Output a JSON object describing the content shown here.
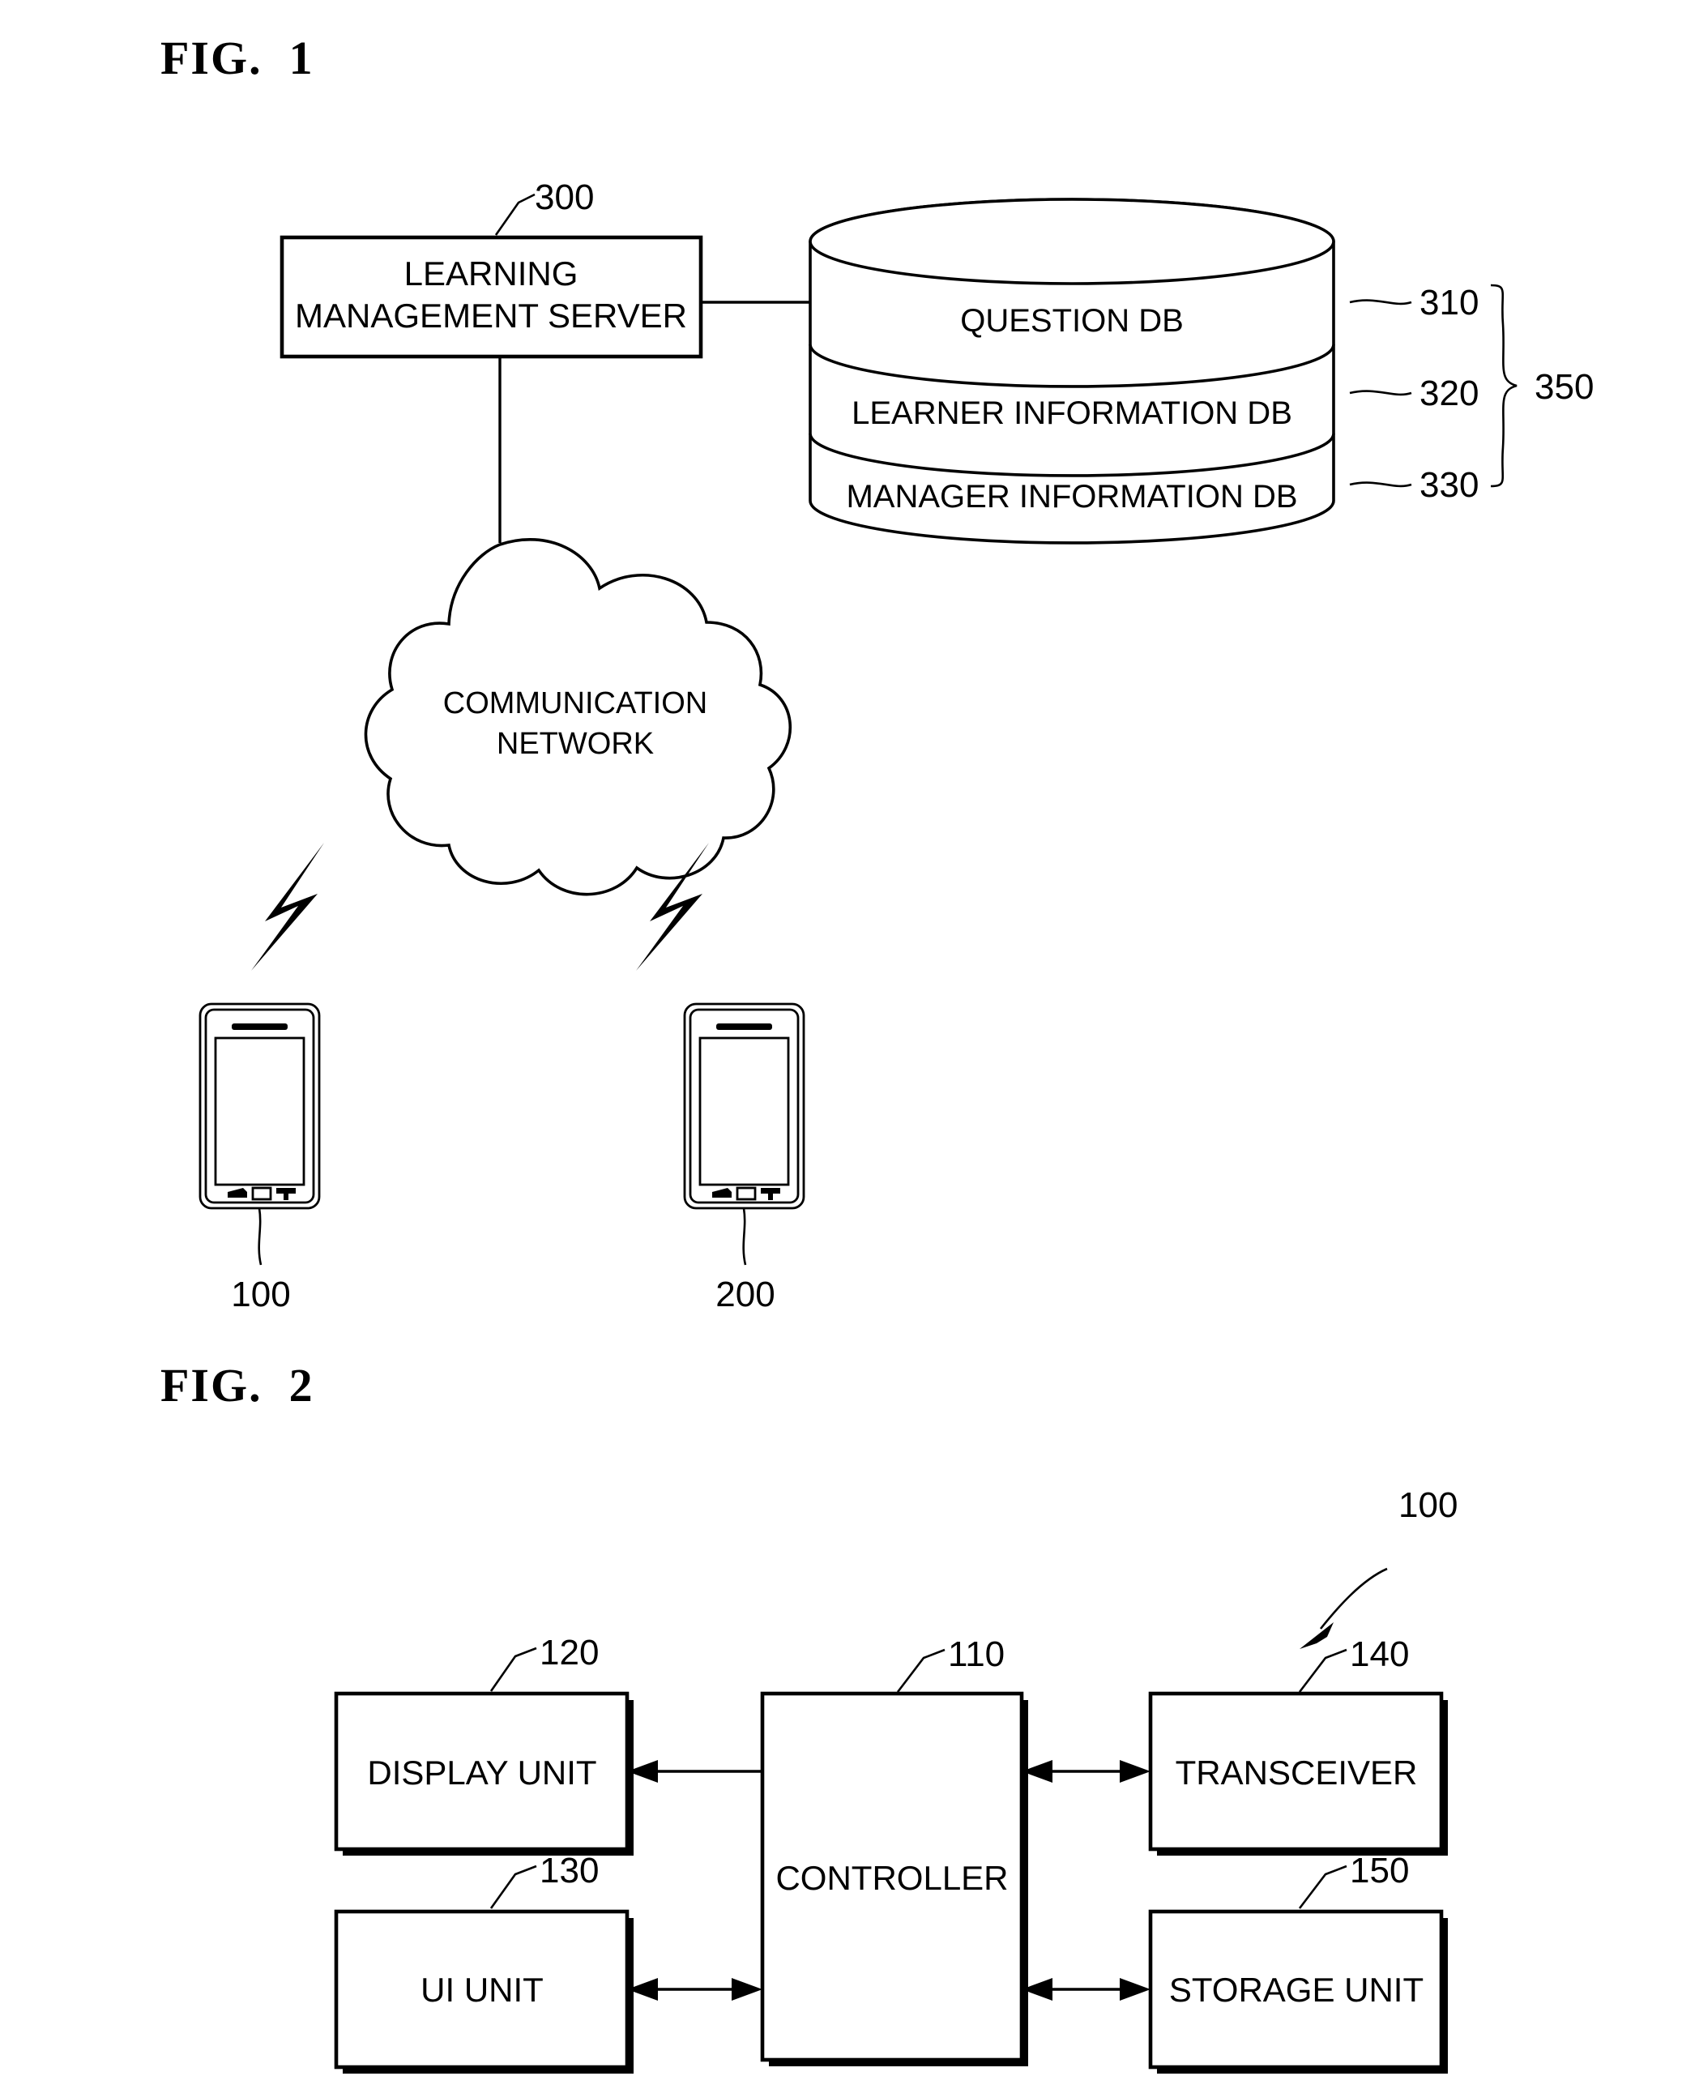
{
  "document": {
    "type": "patent-drawing-sheet",
    "figures": [
      {
        "id": "fig1",
        "title": "FIG.  1",
        "caption_prefix": "FIG.",
        "caption_number": "1"
      },
      {
        "id": "fig2",
        "title": "FIG.  2",
        "caption_prefix": "FIG.",
        "caption_number": "2"
      }
    ]
  },
  "fig1": {
    "title": "FIG.  1",
    "server": {
      "label_line1": "LEARNING",
      "label_line2": "MANAGEMENT SERVER",
      "ref": "300"
    },
    "database": {
      "group_ref": "350",
      "sections": [
        {
          "label": "QUESTION DB",
          "ref": "310"
        },
        {
          "label": "LEARNER INFORMATION DB",
          "ref": "320"
        },
        {
          "label": "MANAGER INFORMATION DB",
          "ref": "330"
        }
      ]
    },
    "network": {
      "label_line1": "COMMUNICATION",
      "label_line2": "NETWORK"
    },
    "terminals": [
      {
        "ref": "100",
        "kind": "mobile-phone"
      },
      {
        "ref": "200",
        "kind": "mobile-phone"
      }
    ]
  },
  "fig2": {
    "title": "FIG.  2",
    "device_ref": "100",
    "blocks": [
      {
        "id": "display",
        "label": "DISPLAY UNIT",
        "ref": "120"
      },
      {
        "id": "controller",
        "label": "CONTROLLER",
        "ref": "110"
      },
      {
        "id": "transceiver",
        "label": "TRANSCEIVER",
        "ref": "140"
      },
      {
        "id": "ui",
        "label": "UI UNIT",
        "ref": "130"
      },
      {
        "id": "storage",
        "label": "STORAGE UNIT",
        "ref": "150"
      }
    ],
    "connections": [
      {
        "from": "controller",
        "to": "display",
        "arrows": "single-left"
      },
      {
        "from": "controller",
        "to": "transceiver",
        "arrows": "double"
      },
      {
        "from": "controller",
        "to": "ui",
        "arrows": "double"
      },
      {
        "from": "controller",
        "to": "storage",
        "arrows": "double"
      }
    ]
  },
  "colors": {
    "ink": "#000000",
    "paper": "#ffffff"
  }
}
